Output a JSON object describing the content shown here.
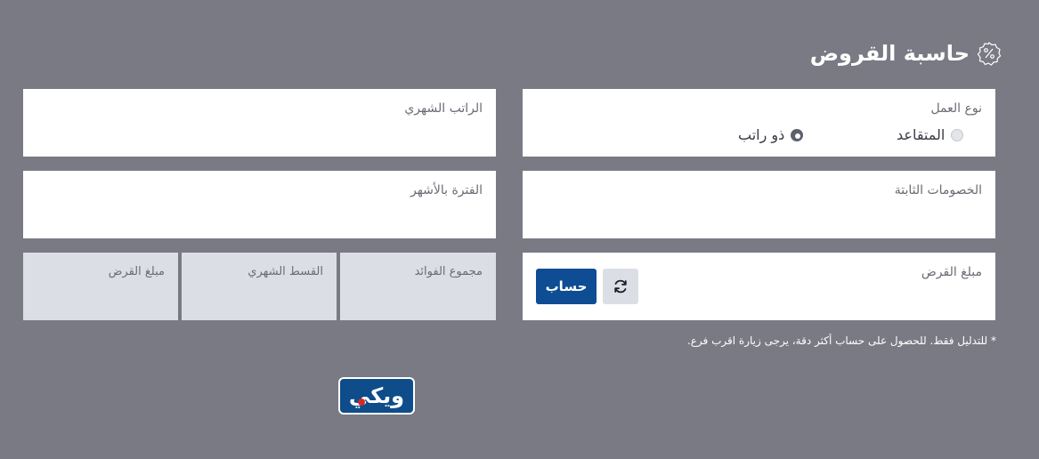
{
  "title": "حاسبة القروض",
  "title_icon": "percent-badge-icon",
  "work_type": {
    "label": "نوع العمل",
    "options": [
      {
        "label": "ذو راتب",
        "selected": true
      },
      {
        "label": "المتقاعد",
        "selected": false
      }
    ]
  },
  "fields": {
    "monthly_salary": {
      "label": "الراتب الشهري",
      "value": ""
    },
    "fixed_deductions": {
      "label": "الخصومات الثابتة",
      "value": ""
    },
    "period_months": {
      "label": "الفترة بالأشهر",
      "value": ""
    },
    "loan_amount": {
      "label": "مبلغ القرض",
      "value": ""
    }
  },
  "results": {
    "loan_amount": {
      "label": "مبلغ القرض",
      "value": ""
    },
    "monthly_installment": {
      "label": "القسط الشهري",
      "value": ""
    },
    "total_interest": {
      "label": "مجموع الفوائد",
      "value": ""
    }
  },
  "actions": {
    "calculate_label": "حساب",
    "reset_icon": "refresh-icon"
  },
  "note": "* للتدليل فقط. للحصول على حساب أكثر دقة، يرجى زيارة اقرب فرع.",
  "logo": {
    "text": "ويكي"
  },
  "colors": {
    "background": "#7a7a85",
    "card": "#ffffff",
    "result_card": "#dcdee5",
    "primary": "#0e4d93",
    "text_muted": "#6b6b75"
  }
}
